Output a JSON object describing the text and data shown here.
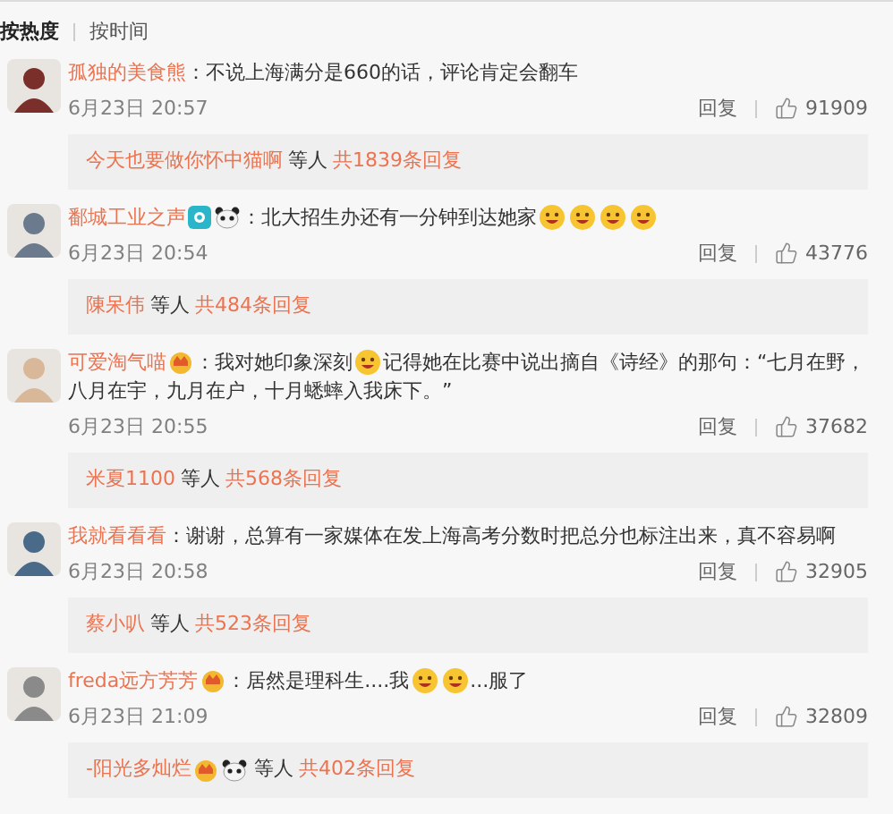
{
  "sort_tabs": [
    {
      "label": "按热度",
      "selected": true
    },
    {
      "label": "按时间",
      "selected": false
    }
  ],
  "comments": [
    {
      "user": "孤独的美食熊",
      "parts": [
        {
          "kind": "text",
          "text": "：不说上海满分是660的话，评论肯定会翻车"
        }
      ],
      "time": "6月23日 20:57",
      "reply": "回复",
      "likes": "91909",
      "replies": {
        "names": "今天也要做你怀中猫啊",
        "suffix": "等人",
        "count": "共1839条回复"
      }
    },
    {
      "user": "鄱城工业之声",
      "badges": [
        {
          "kind": "eye"
        },
        {
          "kind": "panda"
        }
      ],
      "parts": [
        {
          "kind": "text",
          "text": "：北大招生办还有一分钟到达她家"
        },
        {
          "kind": "emoji"
        },
        {
          "kind": "emoji"
        },
        {
          "kind": "emoji"
        },
        {
          "kind": "emoji"
        }
      ],
      "time": "6月23日 20:54",
      "reply": "回复",
      "likes": "43776",
      "replies": {
        "names": "陳呆伟",
        "suffix": "等人",
        "count": "共484条回复"
      }
    },
    {
      "user": "可爱淘气喵",
      "badges": [
        {
          "kind": "crown"
        }
      ],
      "parts": [
        {
          "kind": "text",
          "text": "：我对她印象深刻"
        },
        {
          "kind": "emoji"
        },
        {
          "kind": "text",
          "text": "记得她在比赛中说出摘自《诗经》的那句：“七月在野，八月在宇，九月在户，十月蟋蟀入我床下。”"
        }
      ],
      "time": "6月23日 20:55",
      "reply": "回复",
      "likes": "37682",
      "replies": {
        "names": "米夏1100",
        "suffix": "等人",
        "count": "共568条回复"
      }
    },
    {
      "user": "我就看看看",
      "parts": [
        {
          "kind": "text",
          "text": "：谢谢，总算有一家媒体在发上海高考分数时把总分也标注出来，真不容易啊"
        }
      ],
      "time": "6月23日 20:58",
      "reply": "回复",
      "likes": "32905",
      "replies": {
        "names": "蔡小叭",
        "suffix": "等人",
        "count": "共523条回复"
      }
    },
    {
      "user": "freda远方芳芳",
      "badges": [
        {
          "kind": "crown"
        }
      ],
      "parts": [
        {
          "kind": "text",
          "text": "：居然是理科生....我"
        },
        {
          "kind": "emoji"
        },
        {
          "kind": "emoji"
        },
        {
          "kind": "text",
          "text": "...服了"
        }
      ],
      "time": "6月23日 21:09",
      "reply": "回复",
      "likes": "32809",
      "replies": {
        "names": "-阳光多灿烂",
        "badges": [
          {
            "kind": "crown"
          },
          {
            "kind": "panda"
          }
        ],
        "suffix": "等人",
        "count": "共402条回复"
      }
    }
  ]
}
